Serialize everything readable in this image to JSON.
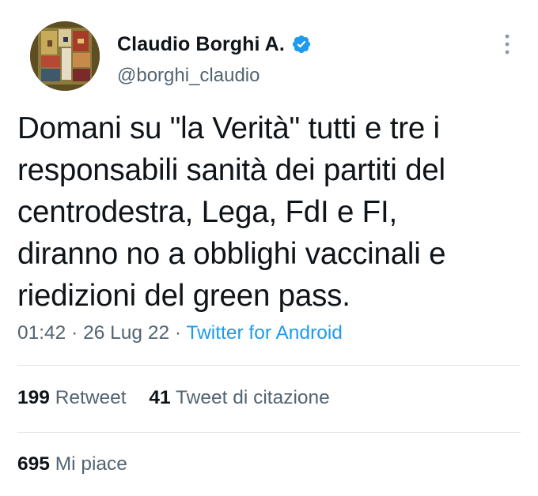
{
  "author": {
    "display_name": "Claudio Borghi A.",
    "handle": "@borghi_claudio",
    "verified": true,
    "avatar_icon": "abstract-painting-avatar",
    "verified_icon": "verified-badge-icon",
    "verified_color": "#1d9bf0"
  },
  "tweet": {
    "text": "Domani su \"la Verità\" tutti e tre i\nresponsabili sanità dei partiti del\ncentrodestra, Lega, FdI e FI,\ndiranno no a obblighi vaccinali e\nriedizioni del green pass.",
    "time": "01:42",
    "separator": "·",
    "date": "26 Lug 22",
    "source": "Twitter for Android",
    "source_color": "#1d9bf0"
  },
  "stats": {
    "retweets_count": "199",
    "retweets_label": "Retweet",
    "quotes_count": "41",
    "quotes_label": "Tweet di citazione",
    "likes_count": "695",
    "likes_label": "Mi piace"
  },
  "menu": {
    "icon": "more-vertical-icon"
  }
}
